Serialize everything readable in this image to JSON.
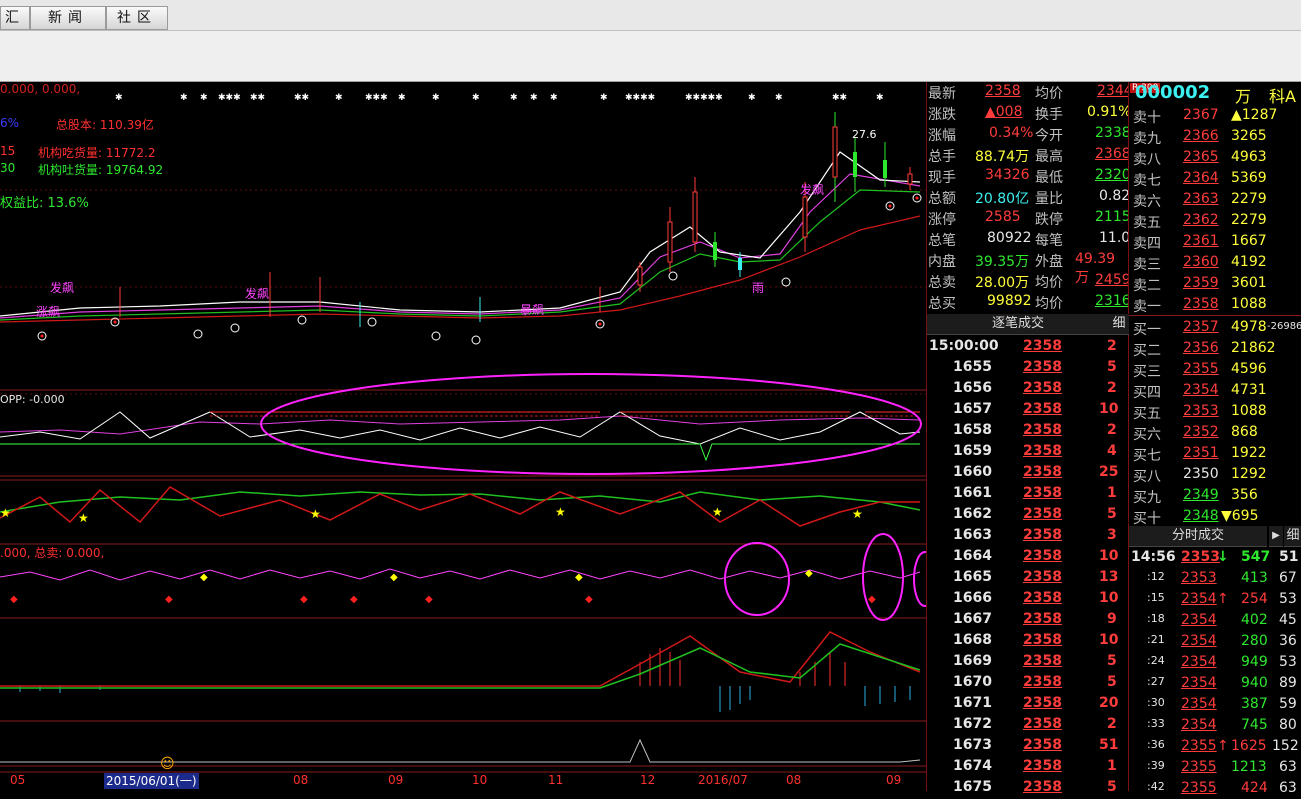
{
  "tabs": [
    {
      "label": "汇"
    },
    {
      "label": "新闻"
    },
    {
      "label": "社区"
    }
  ],
  "chart": {
    "top_info": "0.000, 0.000,",
    "share_label": "总股本: 110.39亿",
    "inst_buy": "机构吃货量: 11772.2",
    "inst_sell": "机构吐货量: 19764.92",
    "left_frag1": "15",
    "left_frag2": "30",
    "left_frag0": "6%",
    "ratio": "权益比: 13.6%",
    "peak_label": "27.6",
    "opp_label": "OPP: -0.000",
    "sell_total": ".000, 总卖: 0.000,",
    "date_cursor": "2015/06/01(一)",
    "time_labels": [
      "05",
      "08",
      "09",
      "10",
      "11",
      "12",
      "2016/07",
      "08",
      "09"
    ]
  },
  "quote": {
    "rows": [
      {
        "l1": "最新",
        "v1": "2358",
        "l2": "均价",
        "v2": "2344"
      },
      {
        "l1": "涨跌",
        "v1": "▲008",
        "l2": "换手",
        "v2": "0.91%"
      },
      {
        "l1": "涨幅",
        "v1": "0.34%",
        "l2": "今开",
        "v2": "2338"
      },
      {
        "l1": "总手",
        "v1": "88.74万",
        "l2": "最高",
        "v2": "2368"
      },
      {
        "l1": "现手",
        "v1": "34326",
        "l2": "最低",
        "v2": "2320"
      },
      {
        "l1": "总额",
        "v1": "20.80亿",
        "l2": "量比",
        "v2": "0.82"
      },
      {
        "l1": "涨停",
        "v1": "2585",
        "l2": "跌停",
        "v2": "2115"
      },
      {
        "l1": "总笔",
        "v1": "80922",
        "l2": "每笔",
        "v2": "11.0"
      },
      {
        "l1": "内盘",
        "v1": "39.35万",
        "l2": "外盘",
        "v2": "49.39万"
      },
      {
        "l1": "总卖",
        "v1": "28.00万",
        "l2": "均价",
        "v2": "2459"
      },
      {
        "l1": "总买",
        "v1": "99892",
        "l2": "均价",
        "v2": "2316"
      }
    ]
  },
  "stock": {
    "badge": "R 300",
    "code": "000002",
    "unit": "万",
    "name": "科A"
  },
  "book": {
    "asks": [
      {
        "label": "卖十",
        "price": "2367",
        "vol": "▲1287"
      },
      {
        "label": "卖九",
        "price": "2366",
        "vol": "3265"
      },
      {
        "label": "卖八",
        "price": "2365",
        "vol": "4963"
      },
      {
        "label": "卖七",
        "price": "2364",
        "vol": "5369"
      },
      {
        "label": "卖六",
        "price": "2363",
        "vol": "2279"
      },
      {
        "label": "卖五",
        "price": "2362",
        "vol": "2279"
      },
      {
        "label": "卖四",
        "price": "2361",
        "vol": "1667"
      },
      {
        "label": "卖三",
        "price": "2360",
        "vol": "4192"
      },
      {
        "label": "卖二",
        "price": "2359",
        "vol": "3601"
      },
      {
        "label": "卖一",
        "price": "2358",
        "vol": "1088"
      }
    ],
    "bids": [
      {
        "label": "买一",
        "price": "2357",
        "vol": "4978",
        "extra": "-26986"
      },
      {
        "label": "买二",
        "price": "2356",
        "vol": "21862",
        "extra": ""
      },
      {
        "label": "买三",
        "price": "2355",
        "vol": "4596",
        "extra": ""
      },
      {
        "label": "买四",
        "price": "2354",
        "vol": "4731",
        "extra": ""
      },
      {
        "label": "买五",
        "price": "2353",
        "vol": "1088",
        "extra": ""
      },
      {
        "label": "买六",
        "price": "2352",
        "vol": "868",
        "extra": ""
      },
      {
        "label": "买七",
        "price": "2351",
        "vol": "1922",
        "extra": ""
      },
      {
        "label": "买八",
        "price": "2350",
        "vol": "1292",
        "extra": ""
      },
      {
        "label": "买九",
        "price": "2349",
        "vol": "356",
        "extra": ""
      },
      {
        "label": "买十",
        "price": "2348",
        "vol": "▼695",
        "extra": ""
      }
    ]
  },
  "ticks": {
    "header": "逐笔成交",
    "detail": "细",
    "rows": [
      {
        "t": "15:00:00",
        "p": "2358",
        "v": "2"
      },
      {
        "t": "1655",
        "p": "2358",
        "v": "5"
      },
      {
        "t": "1656",
        "p": "2358",
        "v": "2"
      },
      {
        "t": "1657",
        "p": "2358",
        "v": "10"
      },
      {
        "t": "1658",
        "p": "2358",
        "v": "2"
      },
      {
        "t": "1659",
        "p": "2358",
        "v": "4"
      },
      {
        "t": "1660",
        "p": "2358",
        "v": "25"
      },
      {
        "t": "1661",
        "p": "2358",
        "v": "1"
      },
      {
        "t": "1662",
        "p": "2358",
        "v": "5"
      },
      {
        "t": "1663",
        "p": "2358",
        "v": "3"
      },
      {
        "t": "1664",
        "p": "2358",
        "v": "10"
      },
      {
        "t": "1665",
        "p": "2358",
        "v": "13"
      },
      {
        "t": "1666",
        "p": "2358",
        "v": "10"
      },
      {
        "t": "1667",
        "p": "2358",
        "v": "9"
      },
      {
        "t": "1668",
        "p": "2358",
        "v": "10"
      },
      {
        "t": "1669",
        "p": "2358",
        "v": "5"
      },
      {
        "t": "1670",
        "p": "2358",
        "v": "5"
      },
      {
        "t": "1671",
        "p": "2358",
        "v": "20"
      },
      {
        "t": "1672",
        "p": "2358",
        "v": "2"
      },
      {
        "t": "1673",
        "p": "2358",
        "v": "51"
      },
      {
        "t": "1674",
        "p": "2358",
        "v": "1"
      },
      {
        "t": "1675",
        "p": "2358",
        "v": "5"
      }
    ]
  },
  "minute": {
    "header": "分时成交",
    "detail": "细",
    "rows": [
      {
        "t": "14:56",
        "p": "2353",
        "arrow": "↓",
        "v": "547",
        "n": "51"
      },
      {
        "t": ":12",
        "p": "2353",
        "arrow": "",
        "v": "413",
        "n": "67"
      },
      {
        "t": ":15",
        "p": "2354",
        "arrow": "↑",
        "v": "254",
        "n": "53"
      },
      {
        "t": ":18",
        "p": "2354",
        "arrow": "",
        "v": "402",
        "n": "45"
      },
      {
        "t": ":21",
        "p": "2354",
        "arrow": "",
        "v": "280",
        "n": "36"
      },
      {
        "t": ":24",
        "p": "2354",
        "arrow": "",
        "v": "949",
        "n": "53"
      },
      {
        "t": ":27",
        "p": "2354",
        "arrow": "",
        "v": "940",
        "n": "89"
      },
      {
        "t": ":30",
        "p": "2354",
        "arrow": "",
        "v": "387",
        "n": "59"
      },
      {
        "t": ":33",
        "p": "2354",
        "arrow": "",
        "v": "745",
        "n": "80"
      },
      {
        "t": ":36",
        "p": "2355",
        "arrow": "↑",
        "v": "1625",
        "n": "152"
      },
      {
        "t": ":39",
        "p": "2355",
        "arrow": "",
        "v": "1213",
        "n": "63"
      },
      {
        "t": ":42",
        "p": "2355",
        "arrow": "",
        "v": "424",
        "n": "63"
      }
    ]
  },
  "colors": {
    "up": "#ff3c3c",
    "down": "#2ee82e",
    "annotation": "#ff22ff",
    "background": "#000000"
  }
}
